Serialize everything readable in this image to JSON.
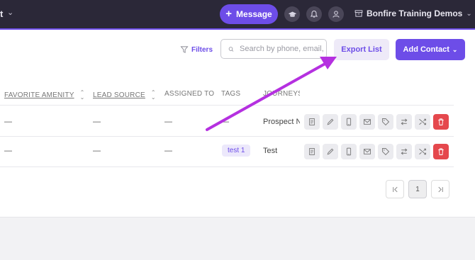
{
  "topbar": {
    "left_fragment": "t",
    "message_label": "Message",
    "org_name": "Bonfire Training Demos"
  },
  "toolbar": {
    "filters_label": "Filters",
    "search_placeholder": "Search by phone, email,",
    "export_label": "Export List",
    "add_contact_label": "Add Contact"
  },
  "table": {
    "columns": [
      "FAVORITE AMENITY",
      "LEAD SOURCE",
      "ASSIGNED TO",
      "TAGS",
      "JOURNEYS"
    ],
    "rows": [
      {
        "favorite_amenity": "—",
        "lead_source": "—",
        "assigned_to": "—",
        "tags": "—",
        "journeys": "Prospect N"
      },
      {
        "favorite_amenity": "—",
        "lead_source": "—",
        "assigned_to": "—",
        "tags": "test 1",
        "journeys": "Test"
      }
    ]
  },
  "pagination": {
    "current_page": "1"
  },
  "colors": {
    "accent": "#6d4de8",
    "annotation_arrow": "#b530e0",
    "delete": "#e5484d",
    "topbar": "#2b2838"
  },
  "icons": [
    "plus-icon",
    "graduation-cap-icon",
    "bell-icon",
    "user-icon",
    "archive-box-icon",
    "chevron-down-icon",
    "filter-icon",
    "search-icon",
    "document-icon",
    "pencil-icon",
    "phone-icon",
    "mail-icon",
    "tag-icon",
    "switch-icon",
    "shuffle-icon",
    "trash-icon",
    "first-page-icon",
    "last-page-icon"
  ]
}
